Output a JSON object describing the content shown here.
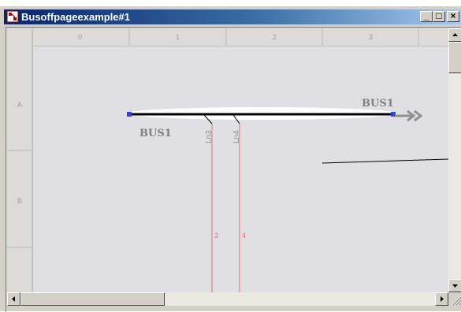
{
  "window": {
    "title": "Busoffpageexample#1",
    "buttons": {
      "minimize": "_",
      "maximize": "□",
      "close": "×"
    }
  },
  "ruler": {
    "columns": [
      "0",
      "1",
      "2",
      "3"
    ],
    "rows": [
      "A",
      "B"
    ]
  },
  "diagram": {
    "bus_label_left": "BUS1",
    "bus_label_right": "BUS1",
    "lines": [
      {
        "label": "Ln3",
        "number": "3"
      },
      {
        "label": "Ln4",
        "number": "4"
      }
    ]
  },
  "colors": {
    "title_gradient_start": "#0a246a",
    "title_gradient_end": "#a6caf0",
    "bus_line": "#000000",
    "branch_line": "#e07070",
    "canvas": "#e0dfe3"
  },
  "icons": [
    "app-icon",
    "minimize-icon",
    "maximize-icon",
    "close-icon",
    "scroll-up-icon",
    "scroll-down-icon",
    "scroll-left-icon",
    "scroll-right-icon",
    "offpage-arrow-icon"
  ]
}
